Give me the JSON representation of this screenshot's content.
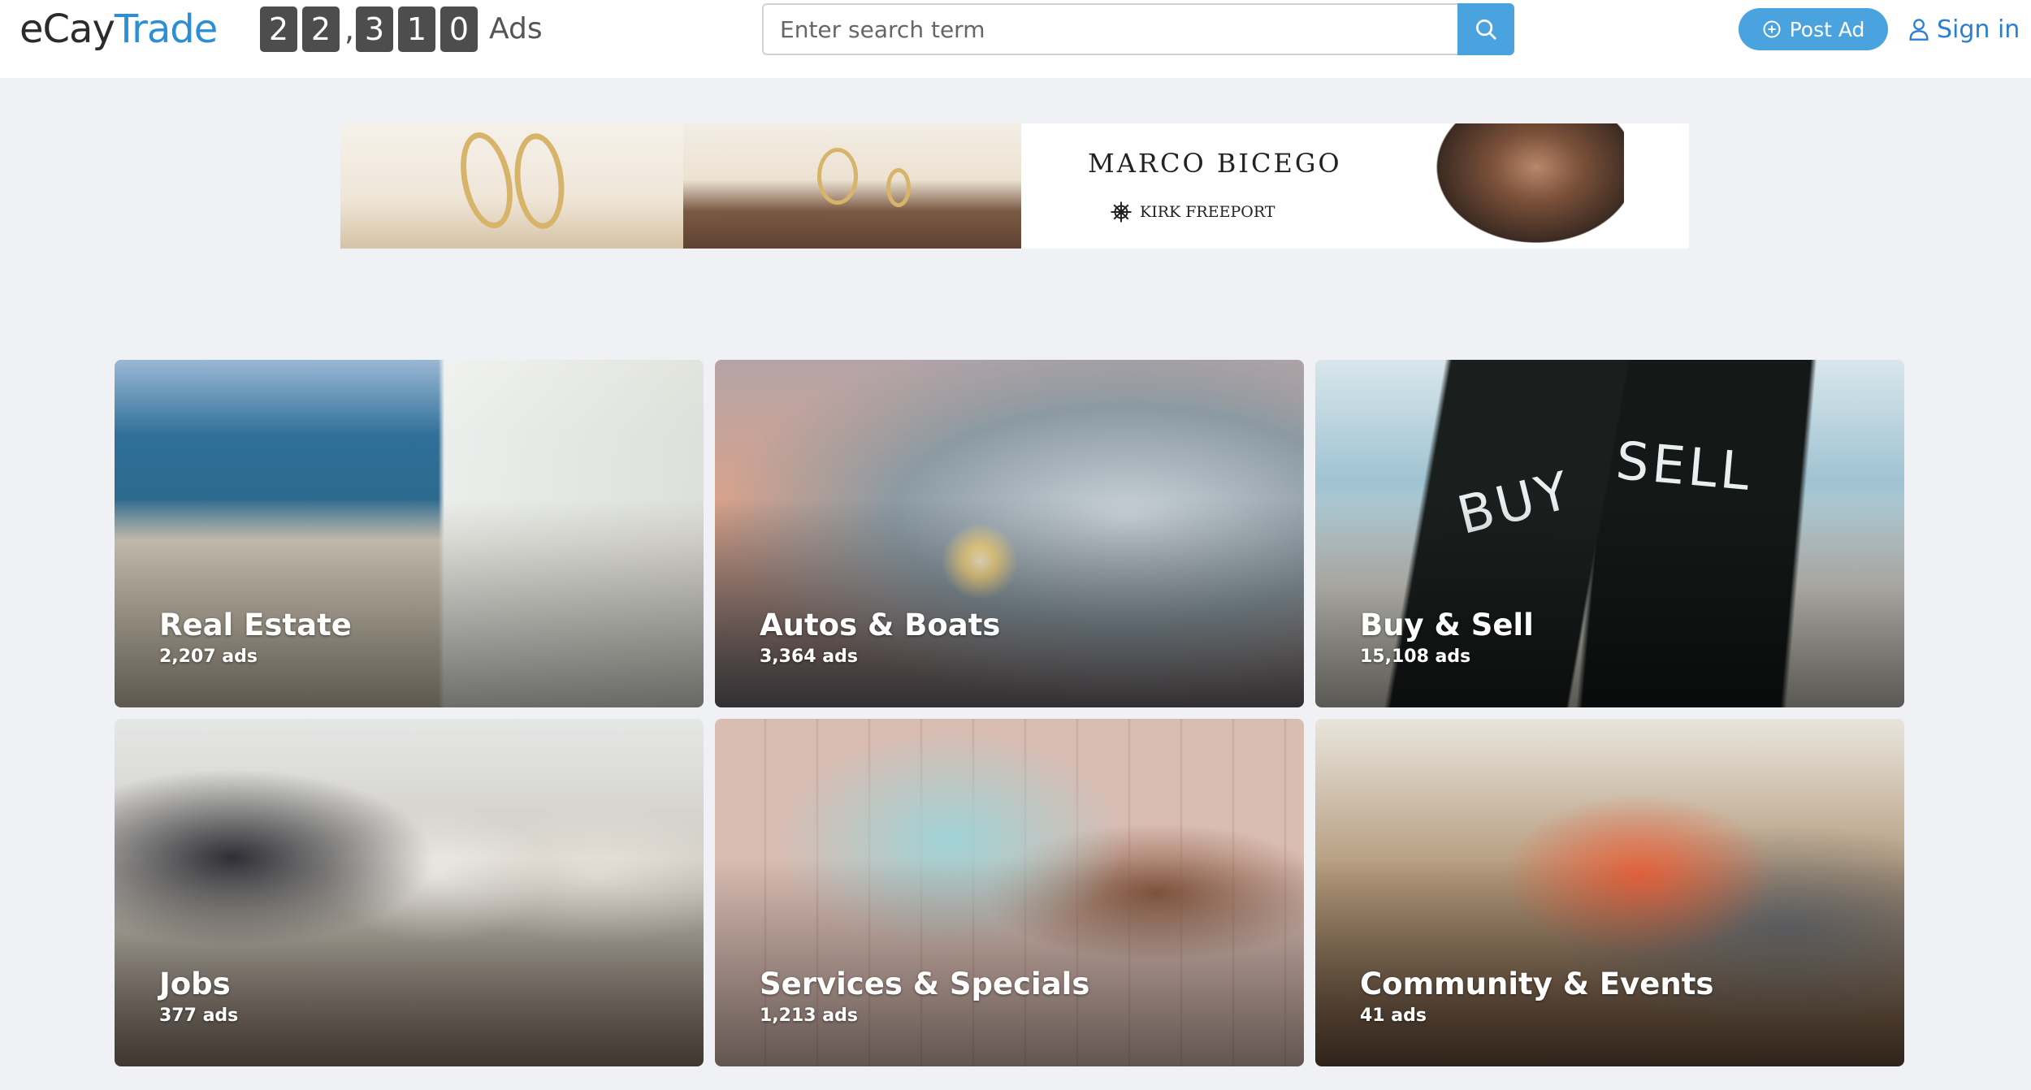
{
  "header": {
    "logo_part1": "eCay",
    "logo_part2": "Trade",
    "counter_digits": [
      "2",
      "2",
      "3",
      "1",
      "0"
    ],
    "counter_separator": ",",
    "counter_suffix": "Ads",
    "search_placeholder": "Enter search term",
    "post_ad_label": "Post Ad",
    "sign_in_label": "Sign in"
  },
  "banner": {
    "brand": "MARCO BICEGO",
    "retailer": "KIRK FREEPORT"
  },
  "categories": [
    {
      "title": "Real Estate",
      "count": "2,207 ads"
    },
    {
      "title": "Autos & Boats",
      "count": "3,364 ads"
    },
    {
      "title": "Buy & Sell",
      "count": "15,108 ads"
    },
    {
      "title": "Jobs",
      "count": "377 ads"
    },
    {
      "title": "Services & Specials",
      "count": "1,213 ads"
    },
    {
      "title": "Community & Events",
      "count": "41 ads"
    }
  ],
  "buysell_cards": [
    "BUY",
    "SELL"
  ],
  "colors": {
    "accent": "#4aa3df",
    "link": "#2a7fd0",
    "counter_bg": "#4d4d4d",
    "page_bg": "#f0f1f4"
  },
  "icons": {
    "search": "search-icon",
    "post_ad": "plus-circle-icon",
    "sign_in": "user-icon"
  }
}
